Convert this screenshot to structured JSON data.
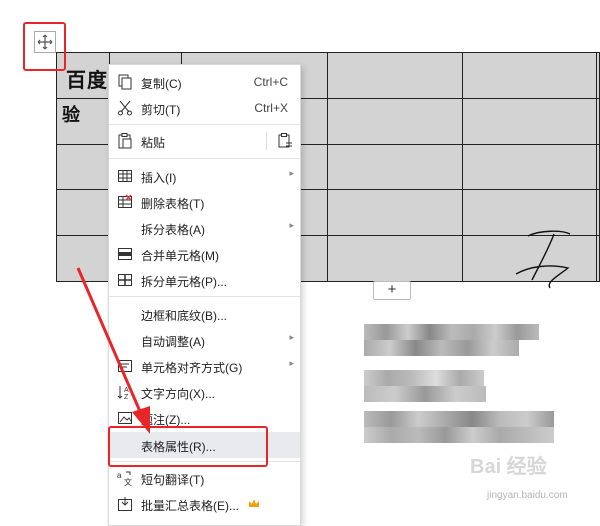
{
  "document": {
    "cell_text_line1": "百度经",
    "cell_text_line2": "验",
    "add_row_label": "+"
  },
  "context_menu": {
    "items": [
      {
        "label": "复制(C)",
        "shortcut": "Ctrl+C",
        "icon": "copy-icon"
      },
      {
        "label": "剪切(T)",
        "shortcut": "Ctrl+X",
        "icon": "cut-icon"
      },
      {
        "label": "粘贴",
        "icon": "paste-icon"
      },
      {
        "label": "插入(I)",
        "icon": "insert-table-icon",
        "submenu": true
      },
      {
        "label": "删除表格(T)",
        "icon": "delete-table-icon"
      },
      {
        "label": "拆分表格(A)",
        "submenu": true
      },
      {
        "label": "合并单元格(M)",
        "icon": "merge-cells-icon"
      },
      {
        "label": "拆分单元格(P)...",
        "icon": "split-cells-icon"
      },
      {
        "label": "边框和底纹(B)..."
      },
      {
        "label": "自动调整(A)",
        "submenu": true
      },
      {
        "label": "单元格对齐方式(G)",
        "icon": "cell-align-icon",
        "submenu": true
      },
      {
        "label": "文字方向(X)...",
        "icon": "text-direction-icon"
      },
      {
        "label": "题注(Z)...",
        "icon": "caption-icon"
      },
      {
        "label": "表格属性(R)...",
        "highlighted": true
      },
      {
        "label": "短句翻译(T)",
        "icon": "translate-icon"
      },
      {
        "label": "批量汇总表格(E)...",
        "icon": "batch-summary-icon",
        "badge": "crown-icon"
      }
    ]
  },
  "colors": {
    "annotation_red": "#e8262a",
    "table_fill": "#d3d3d3",
    "menu_highlight": "#e8eaed"
  },
  "watermark": {
    "brand": "Bai 经验",
    "url": "jingyan.baidu.com"
  }
}
